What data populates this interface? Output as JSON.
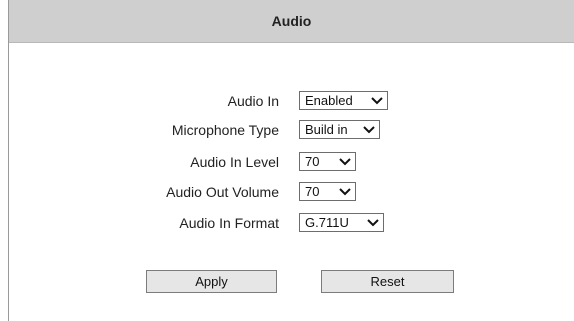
{
  "page": {
    "title": "Audio"
  },
  "form": {
    "fields": [
      {
        "label": "Audio In",
        "value": "Enabled"
      },
      {
        "label": "Microphone Type",
        "value": "Build in"
      },
      {
        "label": "Audio In Level",
        "value": "70"
      },
      {
        "label": "Audio Out Volume",
        "value": "70"
      },
      {
        "label": "Audio In Format",
        "value": "G.711U"
      }
    ]
  },
  "buttons": {
    "apply": "Apply",
    "reset": "Reset"
  },
  "icons": {
    "dropdown": "chevron-down-icon"
  }
}
